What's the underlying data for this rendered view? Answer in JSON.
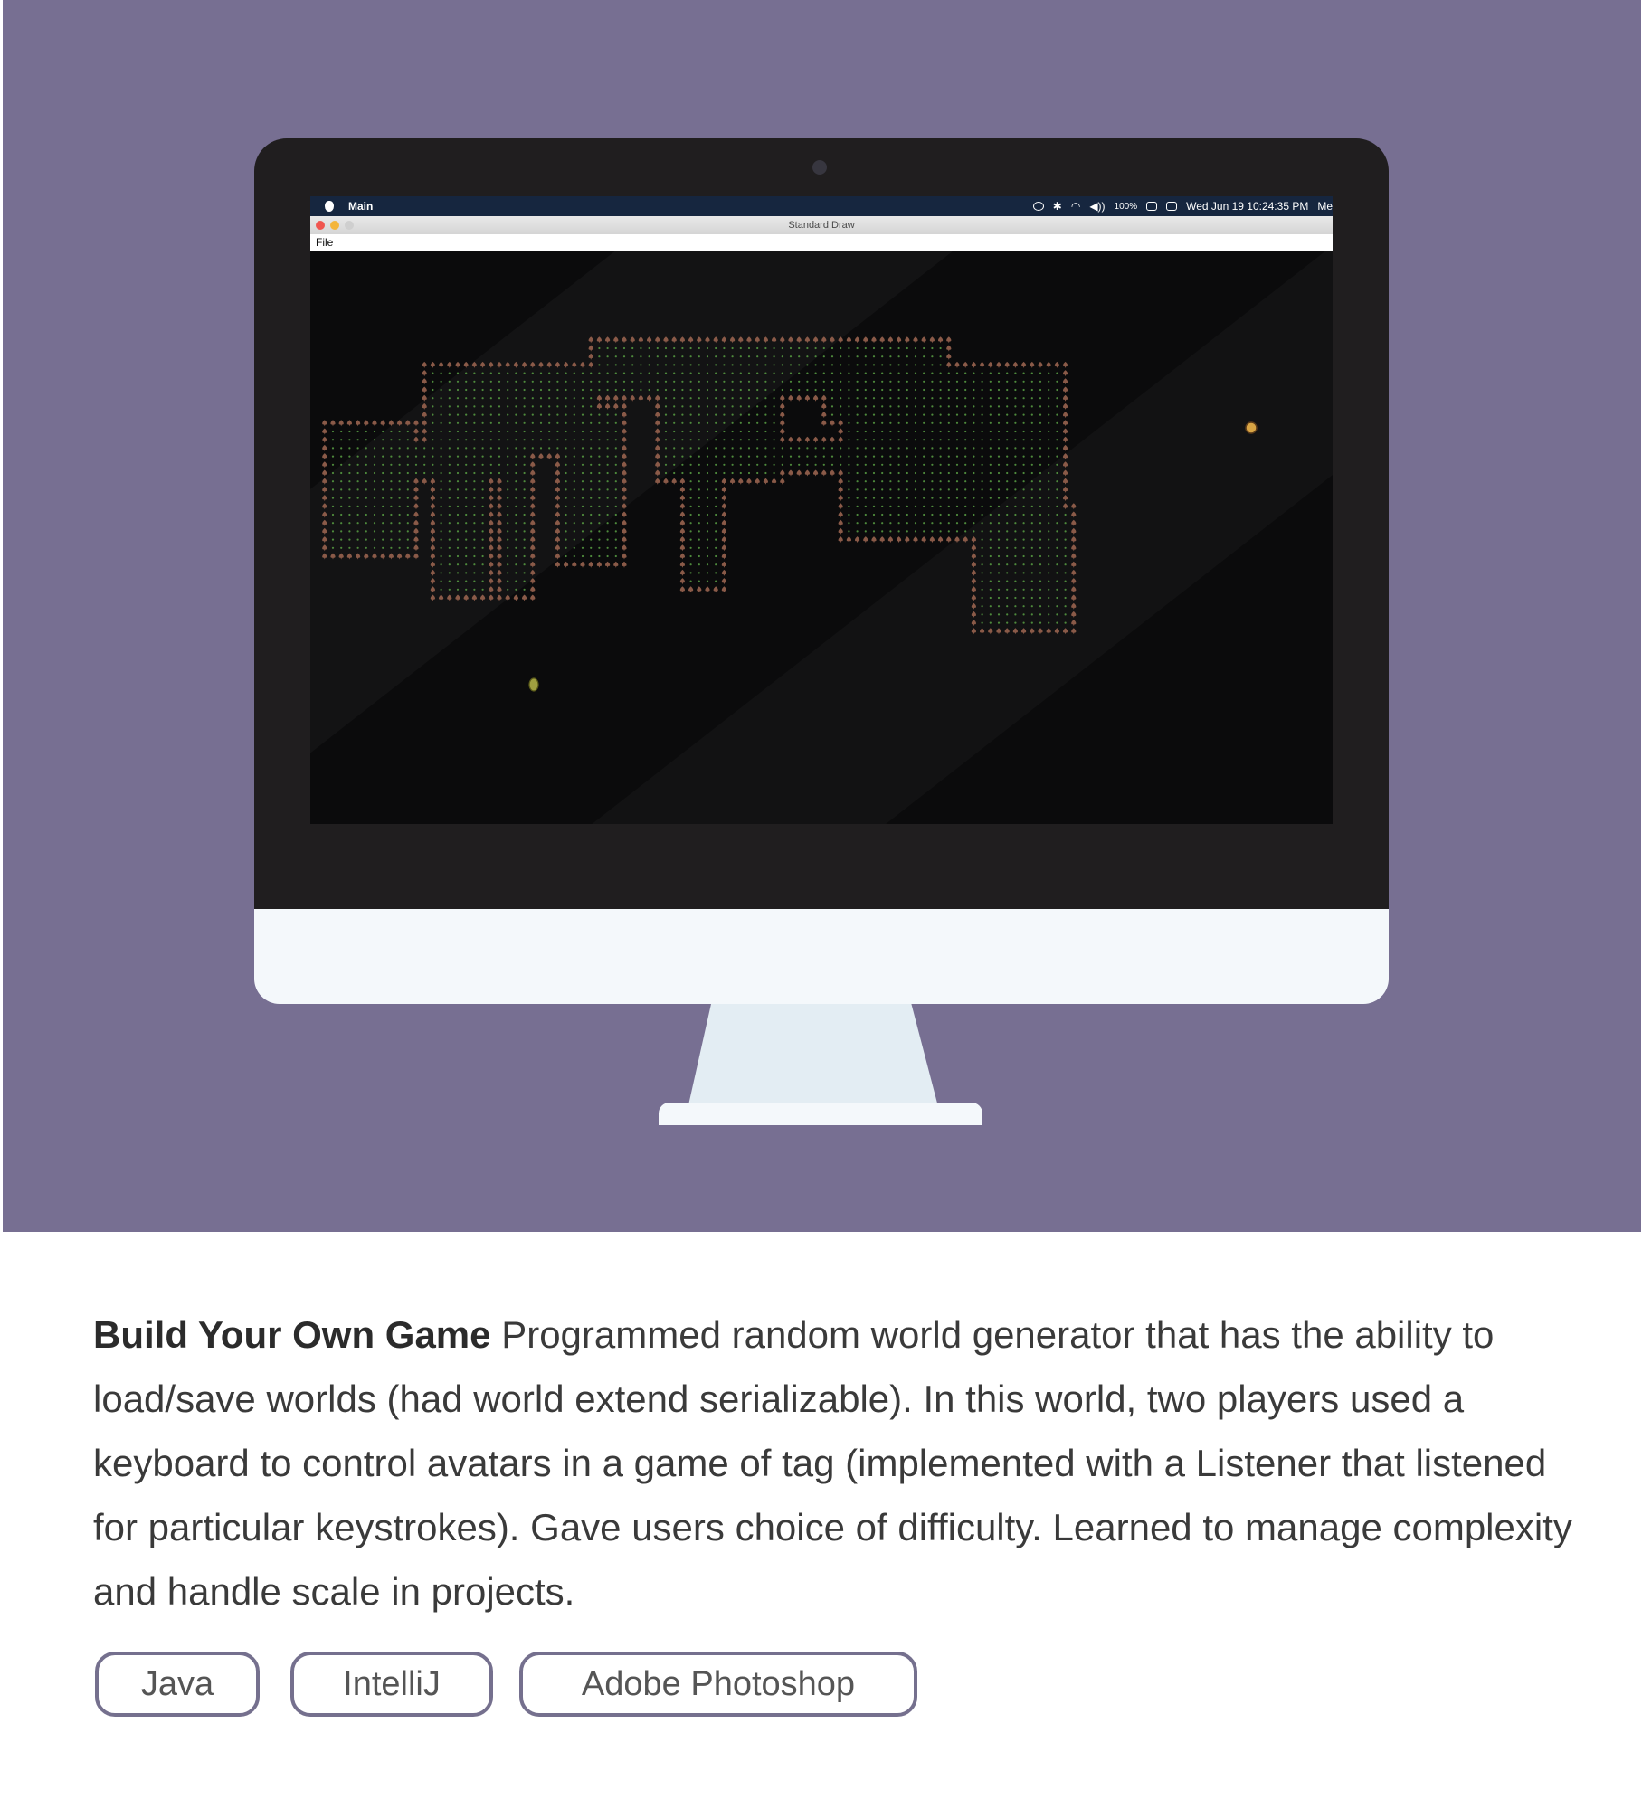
{
  "colors": {
    "hero_background": "#776f92",
    "monitor_bezel": "#201e1f",
    "monitor_chin": "#f4f8fb",
    "tag_border": "#75708e",
    "floor_dot": "#4e8a3c",
    "wall_tile": "#8a5a48",
    "player_one": "#d8a444",
    "player_two": "#a0a040"
  },
  "screen": {
    "menubar": {
      "app_name": "Main",
      "battery": "100%",
      "datetime": "Wed Jun 19  10:24:35 PM",
      "user": "Me"
    },
    "window": {
      "title": "Standard Draw",
      "menu_file": "File"
    }
  },
  "project": {
    "title": "Build Your Own Game",
    "description": "Programmed random world generator that has the ability to load/save worlds (had world extend serializable). In this world, two players used a keyboard to control avatars in a game of tag (implemented with a Listener that listened for particular keystrokes). Gave users choice of difficulty. Learned to manage complexity and handle scale in projects.",
    "tags": [
      "Java",
      "IntelliJ",
      "Adobe Photoshop"
    ]
  }
}
